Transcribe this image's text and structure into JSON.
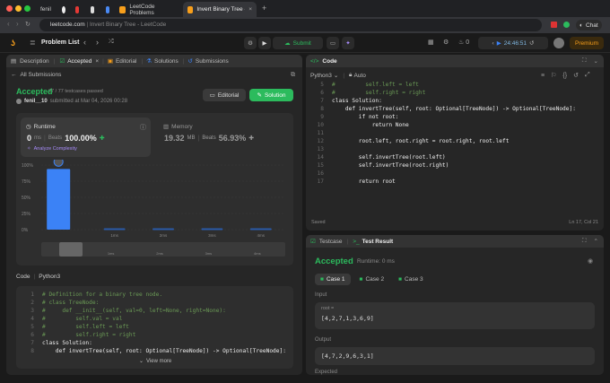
{
  "browser": {
    "profile": "fenil",
    "tabs": [
      {
        "label": "LeetCode Problems"
      },
      {
        "label": "Invert Binary Tree - Lee"
      }
    ],
    "url": "leetcode.com",
    "page_title": "Invert Binary Tree - LeetCode",
    "chat_label": "Chat"
  },
  "nav": {
    "problem_list": "Problem List",
    "submit": "Submit",
    "timer": "24:46:51",
    "streak": "0",
    "premium": "Premium"
  },
  "left": {
    "tabs": [
      "Description",
      "Accepted",
      "Editorial",
      "Solutions",
      "Submissions"
    ],
    "all_submissions": "All Submissions",
    "status": "Accepted",
    "testcases": "77 / 77 testcases passed",
    "user": "fenil__10",
    "submitted": "submitted at Mar 04, 2026 00:28",
    "editorial_btn": "Editorial",
    "solution_btn": "Solution",
    "runtime": {
      "label": "Runtime",
      "value": "0",
      "unit": "ms",
      "beats_label": "Beats",
      "beats": "100.00%",
      "analyze": "Analyze Complexity"
    },
    "memory": {
      "label": "Memory",
      "value": "19.32",
      "unit": "MB",
      "beats_label": "Beats",
      "beats": "56.93%"
    },
    "code_label": "Code",
    "code_lang": "Python3",
    "view_more": "View more"
  },
  "chart_data": {
    "type": "bar",
    "categories": [
      "0ms",
      "1ms",
      "2ms",
      "3ms",
      "4ms"
    ],
    "values": [
      94,
      2,
      2,
      2,
      2
    ],
    "y_ticks": [
      "100%",
      "75%",
      "50%",
      "25%",
      "0%"
    ],
    "ylim": [
      0,
      100
    ],
    "colors": {
      "highlight": "#3b82f6",
      "normal": "#2a5aa8"
    },
    "mini_labels": [
      "1ms",
      "2ms",
      "3ms",
      "4ms"
    ]
  },
  "snippet": [
    {
      "n": "1",
      "t": "# Definition for a binary tree node.",
      "c": "cm"
    },
    {
      "n": "2",
      "t": "# class TreeNode:",
      "c": "cm"
    },
    {
      "n": "3",
      "t": "#     def __init__(self, val=0, left=None, right=None):",
      "c": "cm"
    },
    {
      "n": "4",
      "t": "#         self.val = val",
      "c": "cm"
    },
    {
      "n": "5",
      "t": "#         self.left = left",
      "c": "cm"
    },
    {
      "n": "6",
      "t": "#         self.right = right",
      "c": "cm"
    },
    {
      "n": "7",
      "t": "class Solution:",
      "c": ""
    },
    {
      "n": "8",
      "t": "    def invertTree(self, root: Optional[TreeNode]) -> Optional[TreeNode]:",
      "c": ""
    }
  ],
  "editor": {
    "title": "Code",
    "lang": "Python3",
    "mode": "Auto",
    "saved": "Saved",
    "cursor": "Ln 17, Col 21",
    "lines": [
      {
        "n": "5",
        "t": "#         self.left = left",
        "c": "cm"
      },
      {
        "n": "6",
        "t": "#         self.right = right",
        "c": "cm"
      },
      {
        "n": "7",
        "t": "class Solution:",
        "c": ""
      },
      {
        "n": "8",
        "t": "    def invertTree(self, root: Optional[TreeNode]) -> Optional[TreeNode]:",
        "c": ""
      },
      {
        "n": "9",
        "t": "        if not root:",
        "c": ""
      },
      {
        "n": "10",
        "t": "            return None",
        "c": ""
      },
      {
        "n": "11",
        "t": "",
        "c": ""
      },
      {
        "n": "12",
        "t": "        root.left, root.right = root.right, root.left",
        "c": ""
      },
      {
        "n": "13",
        "t": "",
        "c": ""
      },
      {
        "n": "14",
        "t": "        self.invertTree(root.left)",
        "c": ""
      },
      {
        "n": "15",
        "t": "        self.invertTree(root.right)",
        "c": ""
      },
      {
        "n": "16",
        "t": "",
        "c": ""
      },
      {
        "n": "17",
        "t": "        return root",
        "c": ""
      }
    ]
  },
  "result": {
    "testcase_tab": "Testcase",
    "result_tab": "Test Result",
    "status": "Accepted",
    "runtime": "Runtime: 0 ms",
    "cases": [
      "Case 1",
      "Case 2",
      "Case 3"
    ],
    "input_label": "Input",
    "param": "root =",
    "input": "[4,2,7,1,3,6,9]",
    "output_label": "Output",
    "output": "[4,7,2,9,6,3,1]",
    "expected_label": "Expected"
  }
}
